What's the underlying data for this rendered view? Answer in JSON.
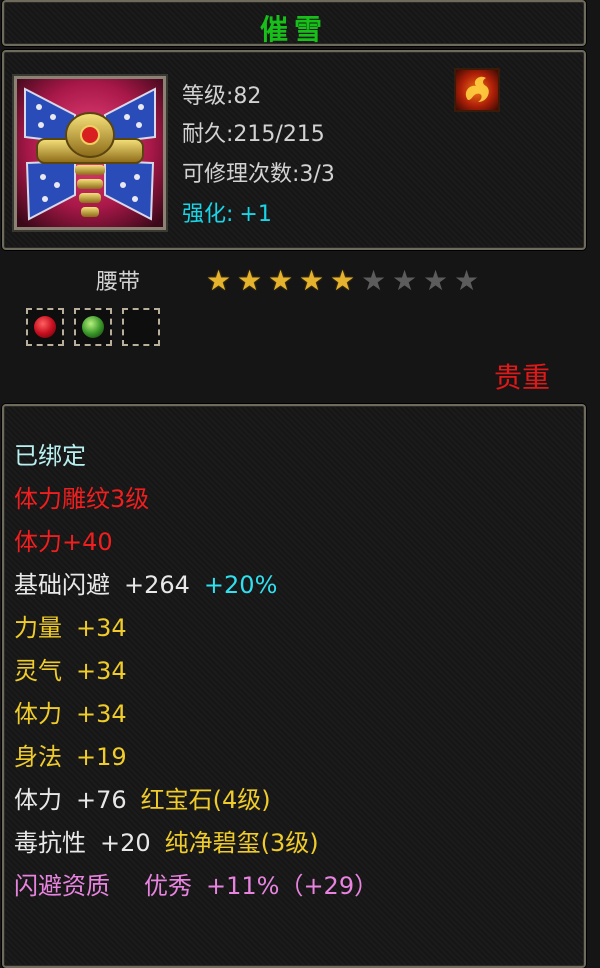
{
  "header": {
    "item_name": "催雪"
  },
  "item": {
    "icon": "waist-belt-icon",
    "level": "等级:82",
    "durability": "耐久:215/215",
    "repairs": "可修理次数:3/3",
    "enhance_label": "强化:",
    "enhance_value": "+1",
    "fire_badge_icon": "fire-element-icon",
    "type": "腰带",
    "stars_filled": 5,
    "stars_total": 9,
    "quality": "贵重"
  },
  "sockets": [
    {
      "gem": "red-gem-icon",
      "color": "#d81e2a"
    },
    {
      "gem": "green-gem-icon",
      "color": "#3c9a2a"
    },
    {
      "gem": "empty-socket",
      "color": ""
    }
  ],
  "attributes": {
    "bound": "已绑定",
    "carving": "体力雕纹3级",
    "carving_bonus": "体力+40",
    "dodge_label": "基础闪避",
    "dodge_value": "+264",
    "dodge_pct": "+20%",
    "str_label": "力量",
    "str_value": "+34",
    "spirit_label": "灵气",
    "spirit_value": "+34",
    "vit_label": "体力",
    "vit_value": "+34",
    "agi_label": "身法",
    "agi_value": "+19",
    "gem_vit_label": "体力",
    "gem_vit_value": "+76",
    "gem_vit_source": "红宝石(4级)",
    "poison_label": "毒抗性",
    "poison_value": "+20",
    "poison_source": "纯净碧玺(3级)",
    "aptitude_label": "闪避资质",
    "aptitude_grade": "优秀",
    "aptitude_value": "+11%（+29）"
  },
  "colors": {
    "title": "#17c018",
    "bound": "#b8f0f0",
    "red": "#f01e1e",
    "gold": "#f0cc2a",
    "cyan": "#2ee0f0",
    "pink": "#e884e0",
    "star": "#e6b32e"
  }
}
